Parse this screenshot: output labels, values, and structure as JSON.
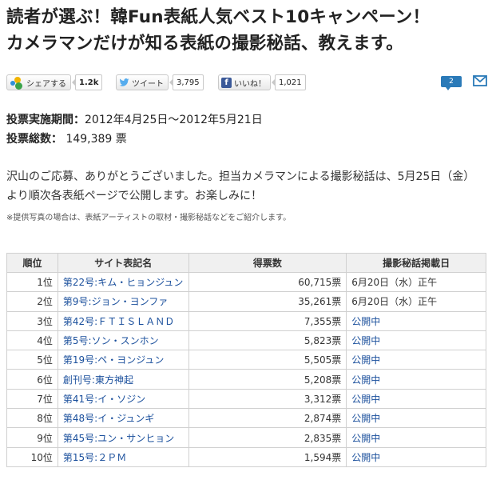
{
  "header": {
    "title_line1": "読者が選ぶ！韓Fun表紙人気ベスト10キャンペーン！",
    "title_line2": "カメラマンだけが知る表紙の撮影秘話、教えます。"
  },
  "share": {
    "hatena_label": "シェアする",
    "hatena_count": "1.2k",
    "tweet_label": "ツイート",
    "tweet_count": "3,795",
    "like_label": "いいね！",
    "like_count": "1,021",
    "comment_count": "2"
  },
  "info": {
    "period_label": "投票実施期間：",
    "period_value": "2012年4月25日〜2012年5月21日",
    "total_label": "投票総数：",
    "total_value": " 149,389 票"
  },
  "message": "沢山のご応募、ありがとうございました。担当カメラマンによる撮影秘話は、5月25日（金）より順次各表紙ページで公開します。お楽しみに！",
  "note": "※提供写真の場合は、表紙アーティストの取材・撮影秘話などをご紹介します。",
  "table": {
    "headers": [
      "順位",
      "サイト表記名",
      "得票数",
      "撮影秘話掲載日"
    ],
    "rows": [
      {
        "rank": "1位",
        "name": "第22号:キム・ヒョンジュン",
        "votes": "60,715票",
        "date": "6月20日（水）正午",
        "is_link": false
      },
      {
        "rank": "2位",
        "name": "第9号:ジョン・ヨンファ",
        "votes": "35,261票",
        "date": "6月20日（水）正午",
        "is_link": false
      },
      {
        "rank": "3位",
        "name": "第42号:ＦＴＩＳＬＡＮＤ",
        "votes": "7,355票",
        "date": "公開中",
        "is_link": true
      },
      {
        "rank": "4位",
        "name": "第5号:ソン・スンホン",
        "votes": "5,823票",
        "date": "公開中",
        "is_link": true
      },
      {
        "rank": "5位",
        "name": "第19号:ペ・ヨンジュン",
        "votes": "5,505票",
        "date": "公開中",
        "is_link": true
      },
      {
        "rank": "6位",
        "name": "創刊号:東方神起",
        "votes": "5,208票",
        "date": "公開中",
        "is_link": true
      },
      {
        "rank": "7位",
        "name": "第41号:イ・ソジン",
        "votes": "3,312票",
        "date": "公開中",
        "is_link": true
      },
      {
        "rank": "8位",
        "name": "第48号:イ・ジュンギ",
        "votes": "2,874票",
        "date": "公開中",
        "is_link": true
      },
      {
        "rank": "9位",
        "name": "第45号:ユン・サンヒョン",
        "votes": "2,835票",
        "date": "公開中",
        "is_link": true
      },
      {
        "rank": "10位",
        "name": "第15号:２ＰＭ",
        "votes": "1,594票",
        "date": "公開中",
        "is_link": true
      }
    ]
  },
  "colors": {
    "link": "#1a4f9c",
    "header_bg": "#f0f0f0",
    "border": "#d0d0d0",
    "comment_badge": "#2a7ab8",
    "facebook": "#3b5998",
    "twitter": "#55acee"
  },
  "icons": [
    "hatena-bookmark-icon",
    "twitter-bird-icon",
    "facebook-icon",
    "comment-icon",
    "mail-icon"
  ]
}
